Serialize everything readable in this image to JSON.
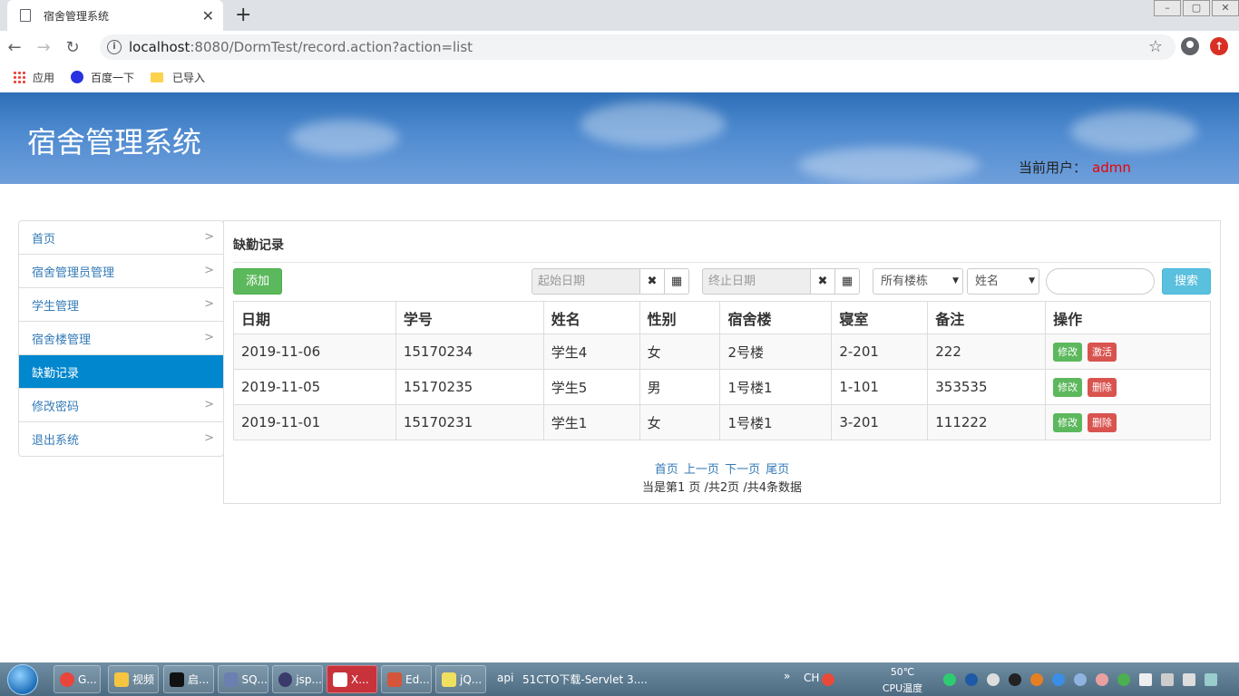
{
  "browser": {
    "tab_title": "宿舍管理系统",
    "tab_close": "✕",
    "new_tab": "+",
    "url_host": "localhost",
    "url_rest": ":8080/DormTest/record.action?action=list",
    "window_controls": [
      "–",
      "▢",
      "✕"
    ],
    "bookmarks": [
      "应用",
      "百度一下",
      "已导入"
    ]
  },
  "header": {
    "title": "宿舍管理系统",
    "current_user_label": "当前用户：",
    "current_user": "admn"
  },
  "sidebar": {
    "items": [
      {
        "label": "首页"
      },
      {
        "label": "宿舍管理员管理"
      },
      {
        "label": "学生管理"
      },
      {
        "label": "宿舍楼管理"
      },
      {
        "label": "缺勤记录",
        "active": true
      },
      {
        "label": "修改密码"
      },
      {
        "label": "退出系统"
      }
    ]
  },
  "main": {
    "title": "缺勤记录",
    "add_label": "添加",
    "start_date_placeholder": "起始日期",
    "end_date_placeholder": "终止日期",
    "clear_glyph": "✖",
    "calendar_glyph": "▦",
    "building_select": "所有楼栋",
    "field_select": "姓名",
    "search_label": "搜索",
    "columns": [
      "日期",
      "学号",
      "姓名",
      "性别",
      "宿舍楼",
      "寝室",
      "备注",
      "操作"
    ],
    "rows": [
      {
        "date": "2019-11-06",
        "sno": "15170234",
        "name": "学生4",
        "sex": "女",
        "building": "2号楼",
        "room": "2-201",
        "note": "222",
        "edit": "修改",
        "action2": "激活"
      },
      {
        "date": "2019-11-05",
        "sno": "15170235",
        "name": "学生5",
        "sex": "男",
        "building": "1号楼1",
        "room": "1-101",
        "note": "353535",
        "edit": "修改",
        "action2": "删除"
      },
      {
        "date": "2019-11-01",
        "sno": "15170231",
        "name": "学生1",
        "sex": "女",
        "building": "1号楼1",
        "room": "3-201",
        "note": "111222",
        "edit": "修改",
        "action2": "删除"
      }
    ],
    "pager": {
      "first": "首页",
      "prev": "上一页",
      "next": "下一页",
      "last": "尾页",
      "info": "当是第1 页 /共2页  /共4条数据"
    }
  },
  "taskbar": {
    "tasks": [
      "G...",
      "视频",
      "启...",
      "SQ...",
      "jsp...",
      "X...",
      "Ed...",
      "jQ..."
    ],
    "api_label": "api",
    "active_window": "51CTO下载-Servlet 3....",
    "ime": "CH",
    "temp": "50℃",
    "temp_label": "CPU温度"
  }
}
